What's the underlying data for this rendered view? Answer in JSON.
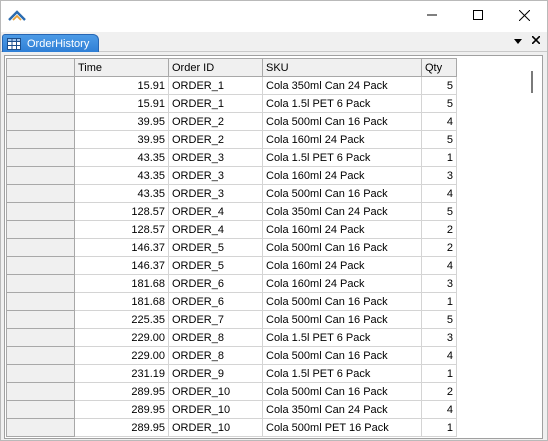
{
  "window": {
    "icon": "anylogic-logo-icon",
    "buttons": {
      "minimize": "minimize-icon",
      "maximize": "maximize-icon",
      "close": "close-icon"
    }
  },
  "tab": {
    "label": "OrderHistory",
    "icon": "table-icon",
    "menu_icon": "chevron-down-icon",
    "close_icon": "close-icon",
    "accent": "#2f7fd6"
  },
  "table": {
    "headers": [
      "Time",
      "Order ID",
      "SKU",
      "Qty"
    ],
    "rows": [
      [
        "15.91",
        "ORDER_1",
        "Cola 350ml Can 24 Pack",
        "5"
      ],
      [
        "15.91",
        "ORDER_1",
        "Cola 1.5l PET 6 Pack",
        "5"
      ],
      [
        "39.95",
        "ORDER_2",
        "Cola 500ml Can 16 Pack",
        "4"
      ],
      [
        "39.95",
        "ORDER_2",
        "Cola 160ml 24 Pack",
        "5"
      ],
      [
        "43.35",
        "ORDER_3",
        "Cola 1.5l PET 6 Pack",
        "1"
      ],
      [
        "43.35",
        "ORDER_3",
        "Cola 160ml 24 Pack",
        "3"
      ],
      [
        "43.35",
        "ORDER_3",
        "Cola 500ml Can 16 Pack",
        "4"
      ],
      [
        "128.57",
        "ORDER_4",
        "Cola 350ml Can 24 Pack",
        "5"
      ],
      [
        "128.57",
        "ORDER_4",
        "Cola 160ml 24 Pack",
        "2"
      ],
      [
        "146.37",
        "ORDER_5",
        "Cola 500ml Can 16 Pack",
        "2"
      ],
      [
        "146.37",
        "ORDER_5",
        "Cola 160ml 24 Pack",
        "4"
      ],
      [
        "181.68",
        "ORDER_6",
        "Cola 160ml 24 Pack",
        "3"
      ],
      [
        "181.68",
        "ORDER_6",
        "Cola 500ml Can 16 Pack",
        "1"
      ],
      [
        "225.35",
        "ORDER_7",
        "Cola 500ml Can 16 Pack",
        "5"
      ],
      [
        "229.00",
        "ORDER_8",
        "Cola 1.5l PET 6 Pack",
        "3"
      ],
      [
        "229.00",
        "ORDER_8",
        "Cola 500ml Can 16 Pack",
        "4"
      ],
      [
        "231.19",
        "ORDER_9",
        "Cola 1.5l PET 6 Pack",
        "1"
      ],
      [
        "289.95",
        "ORDER_10",
        "Cola 500ml Can 16 Pack",
        "2"
      ],
      [
        "289.95",
        "ORDER_10",
        "Cola 350ml Can 24 Pack",
        "4"
      ],
      [
        "289.95",
        "ORDER_10",
        "Cola 500ml PET 16 Pack",
        "1"
      ]
    ]
  }
}
